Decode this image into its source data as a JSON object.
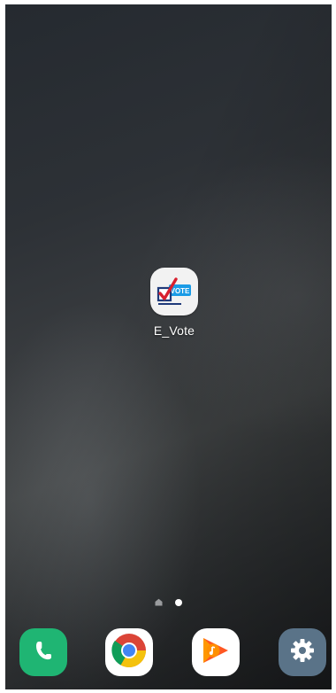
{
  "home_screen": {
    "apps": [
      {
        "label": "E_Vote",
        "icon": "e-vote-ballot-icon"
      }
    ],
    "page_indicator": {
      "pages": 2,
      "current_page": 2,
      "home_marker": "home-page-icon"
    }
  },
  "dock": [
    {
      "name": "phone",
      "icon": "phone-icon",
      "color": "#1fb573"
    },
    {
      "name": "chrome",
      "icon": "chrome-icon",
      "color": "#ffffff"
    },
    {
      "name": "play-music",
      "icon": "play-music-icon",
      "color": "#ffffff"
    },
    {
      "name": "settings",
      "icon": "gear-icon",
      "color": "#5a7388"
    }
  ],
  "colors": {
    "vote_red": "#d8202e",
    "vote_blue": "#1a9be6",
    "vote_navy": "#1f3a7a"
  },
  "badge_text": "VOTE"
}
